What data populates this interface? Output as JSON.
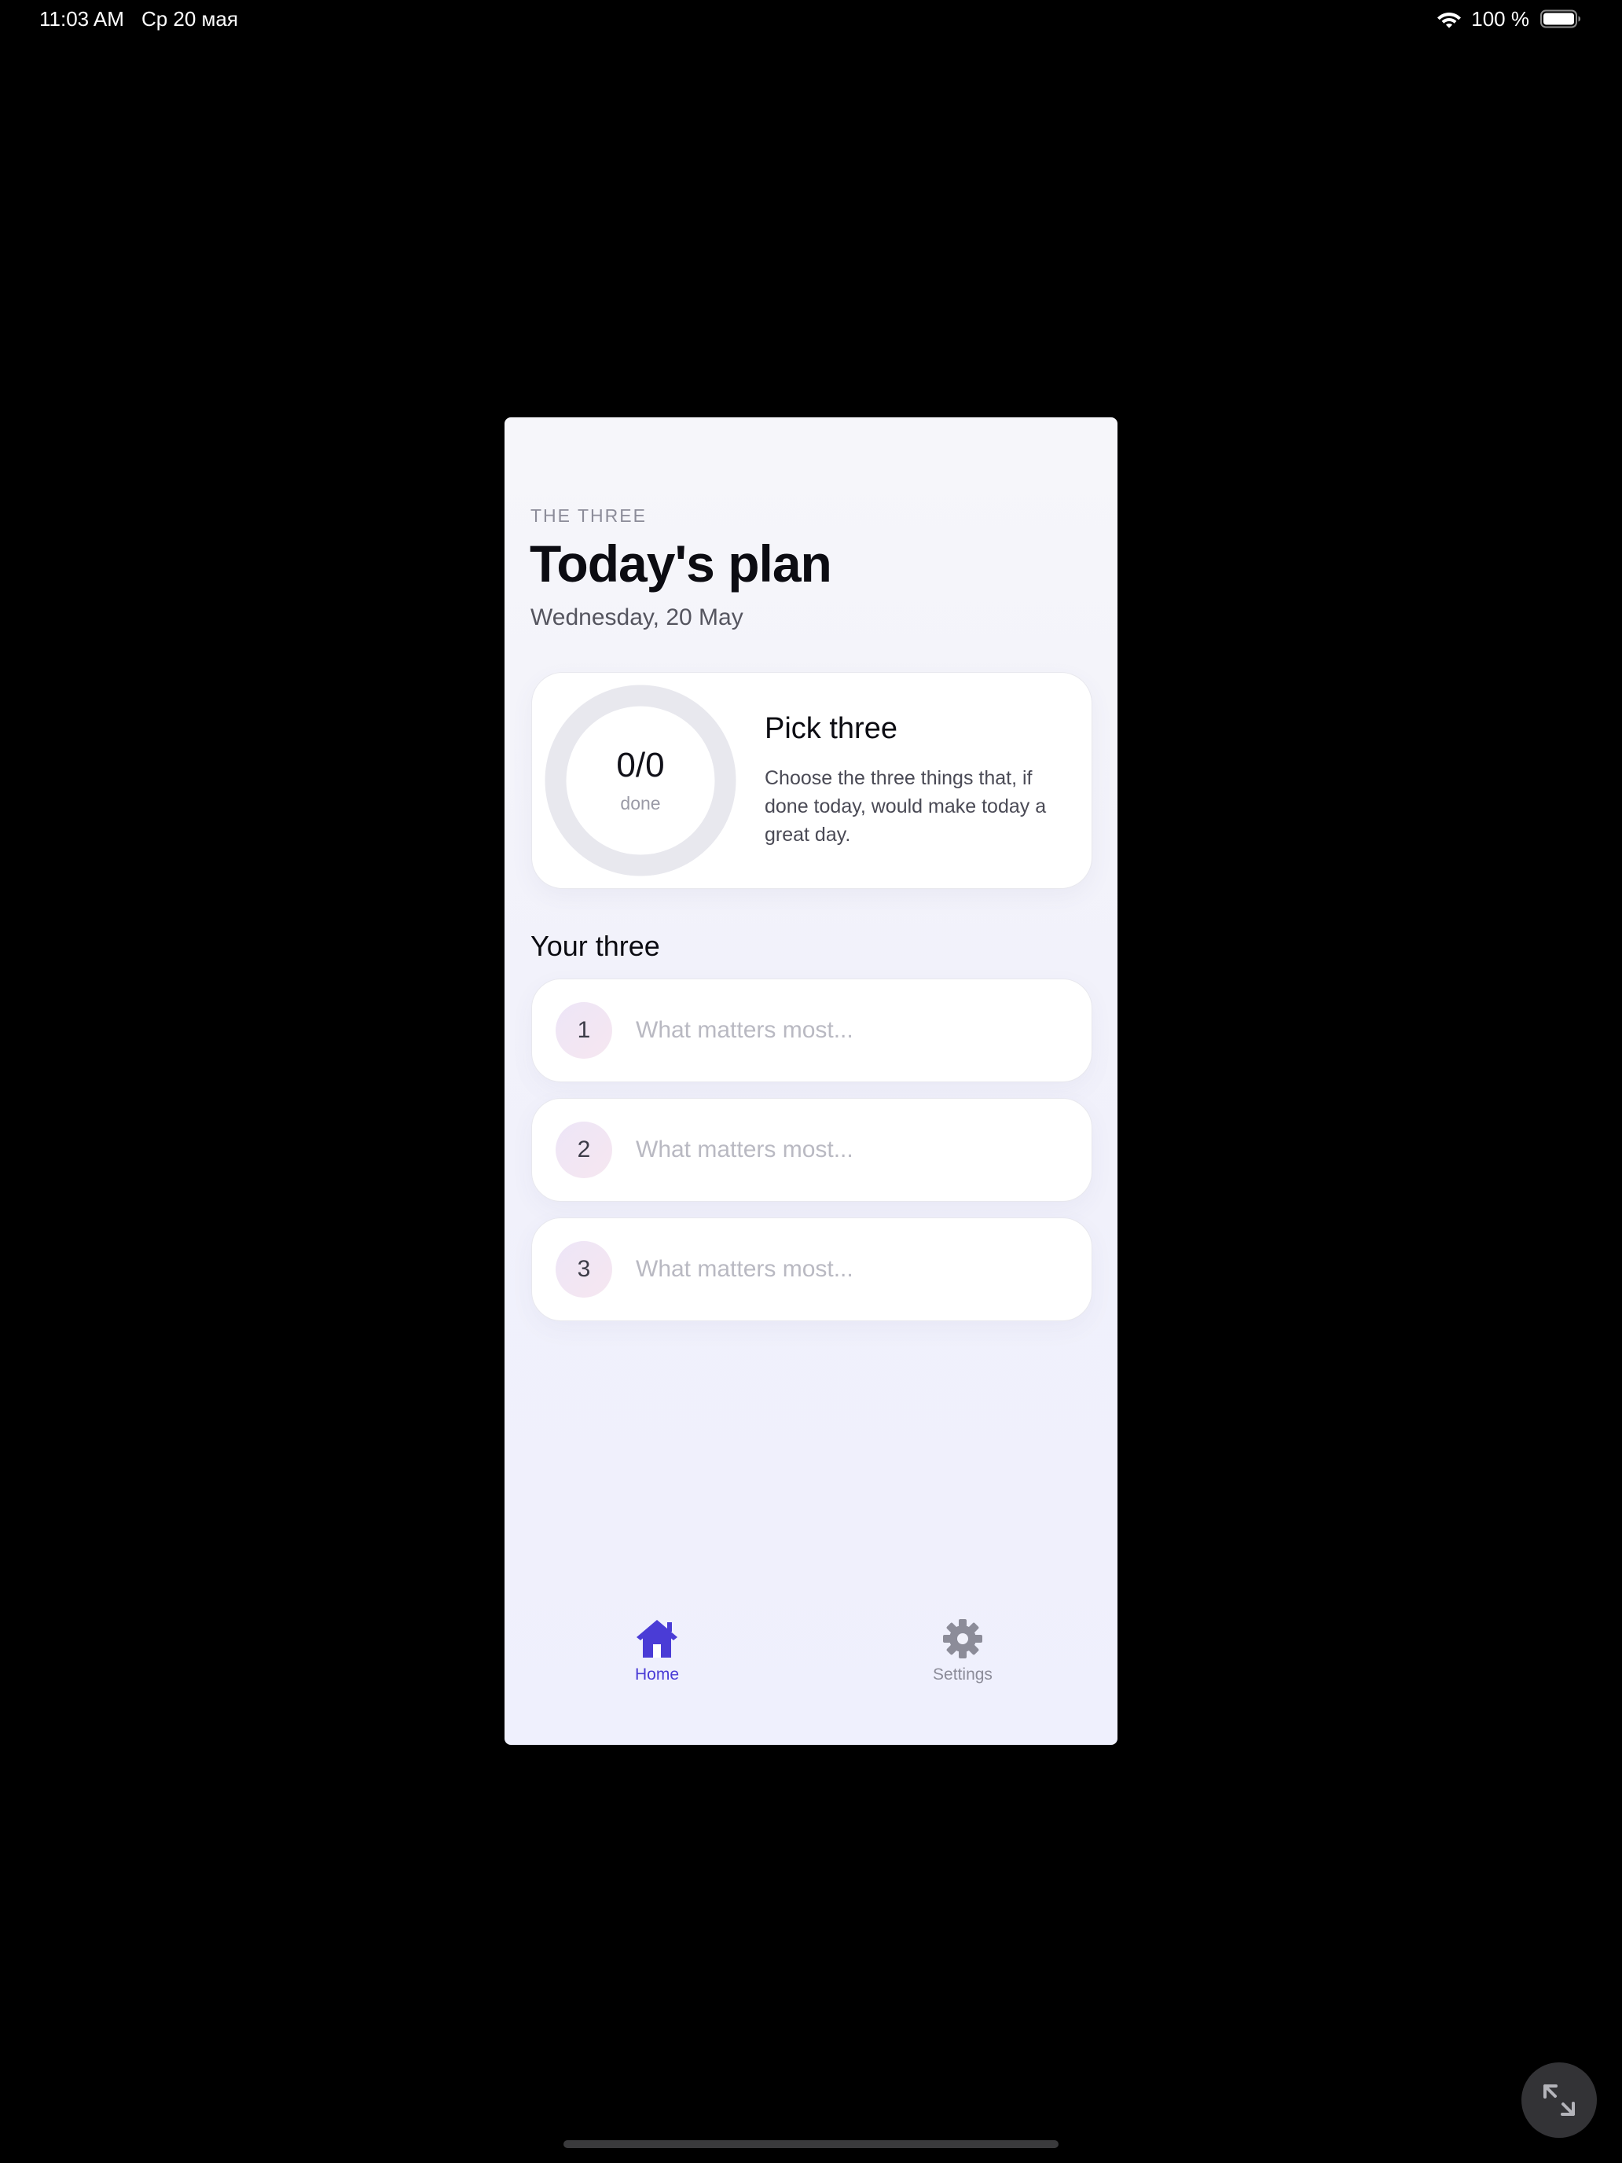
{
  "status_bar": {
    "time": "11:03 AM",
    "date": "Ср 20 мая",
    "battery_percent": "100 %",
    "battery_level": 1.0
  },
  "header": {
    "eyebrow": "THE THREE",
    "title": "Today's plan",
    "date": "Wednesday, 20 May"
  },
  "progress_card": {
    "count": "0/0",
    "label": "done",
    "progress": 0,
    "title": "Pick three",
    "description": "Choose the three things that, if done today, would make today a great day."
  },
  "your_three": {
    "title": "Your three",
    "items": [
      {
        "number": "1",
        "value": "",
        "placeholder": "What matters most..."
      },
      {
        "number": "2",
        "value": "",
        "placeholder": "What matters most..."
      },
      {
        "number": "3",
        "value": "",
        "placeholder": "What matters most..."
      }
    ]
  },
  "tab_bar": {
    "home": {
      "label": "Home",
      "icon": "home-icon",
      "active": true
    },
    "settings": {
      "label": "Settings",
      "icon": "gear-icon",
      "active": false
    }
  },
  "colors": {
    "accent": "#4a3cd6",
    "inactive": "#8c8c99",
    "ring_track": "#e8e8ee"
  }
}
